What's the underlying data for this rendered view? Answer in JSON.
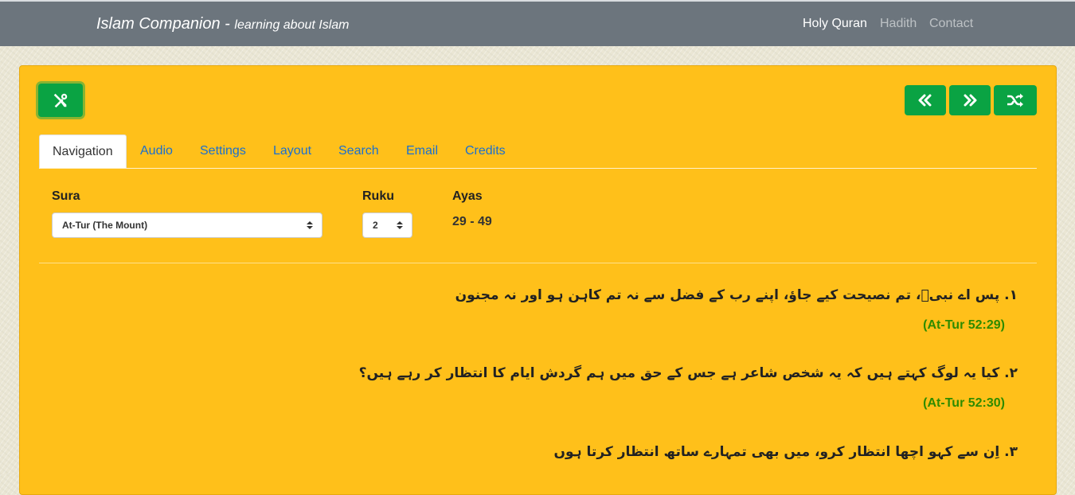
{
  "header": {
    "brand_title": "Islam Companion",
    "brand_separator": " - ",
    "brand_subtitle": "learning about Islam",
    "nav": [
      {
        "label": "Holy Quran",
        "active": true
      },
      {
        "label": "Hadith",
        "active": false
      },
      {
        "label": "Contact",
        "active": false
      }
    ]
  },
  "toolbar": {
    "tools_icon": "tools-icon",
    "prev_icon": "double-chevron-left-icon",
    "next_icon": "double-chevron-right-icon",
    "random_icon": "shuffle-icon",
    "button_color": "#0aa343"
  },
  "tabs": [
    {
      "label": "Navigation",
      "active": true
    },
    {
      "label": "Audio"
    },
    {
      "label": "Settings"
    },
    {
      "label": "Layout"
    },
    {
      "label": "Search"
    },
    {
      "label": "Email"
    },
    {
      "label": "Credits"
    }
  ],
  "navigation": {
    "sura_label": "Sura",
    "sura_selected": "At-Tur (The Mount)",
    "ruku_label": "Ruku",
    "ruku_selected": "2",
    "ayas_label": "Ayas",
    "ayas_value": "29 - 49"
  },
  "verses": [
    {
      "number": "۱.",
      "text": "پس اے نبیؐ، تم نصیحت کیے جاؤ، اپنے رب کے فضل سے نہ تم کاہن ہو اور نہ مجنون",
      "ref": "(At-Tur 52:29)"
    },
    {
      "number": "۲.",
      "text": "کیا یہ لوگ کہتے ہیں کہ یہ شخص شاعر ہے جس کے حق میں ہم گردش ایام کا انتظار کر رہے ہیں؟",
      "ref": "(At-Tur 52:30)"
    },
    {
      "number": "۳.",
      "text": "اِن سے کہو اچھا انتظار کرو، میں بھی تمہارے ساتھ انتظار کرتا ہوں",
      "ref": ""
    }
  ],
  "colors": {
    "header_bg": "#6c757d",
    "card_bg": "#ffc01a",
    "link": "#1a6fd0",
    "reference": "#2e8b00"
  }
}
